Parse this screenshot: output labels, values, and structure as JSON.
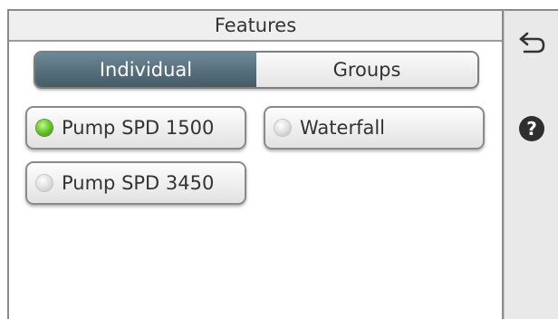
{
  "header": {
    "title": "Features"
  },
  "segmented": {
    "individual_label": "Individual",
    "groups_label": "Groups",
    "selected": "Individual"
  },
  "features": [
    {
      "label": "Pump SPD 1500",
      "state": "on"
    },
    {
      "label": "Waterfall",
      "state": "off"
    },
    {
      "label": "Pump SPD 3450",
      "state": "off"
    }
  ],
  "sidebar": {
    "back_icon": "back-arrow-icon",
    "help_icon": "help-icon",
    "help_glyph": "?"
  },
  "colors": {
    "active_tab": "#4e6774",
    "led_on": "#6ccc2d",
    "led_off": "#d6d6d6"
  }
}
